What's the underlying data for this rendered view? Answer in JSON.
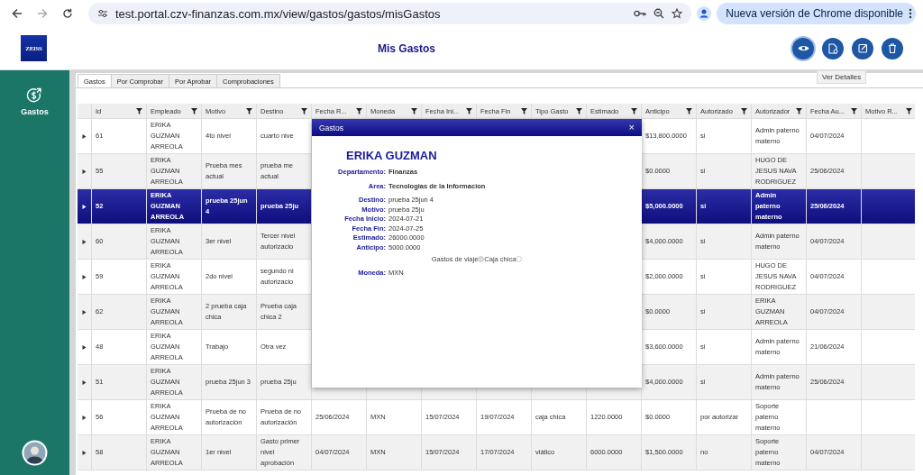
{
  "browser": {
    "url": "test.portal.czv-finanzas.com.mx/view/gastos/gastos/misGastos",
    "update_button": "Nueva versión de Chrome disponible"
  },
  "header": {
    "logo": "ZEISS",
    "title": "Mis Gastos",
    "tooltip": "Ver Detalles",
    "actions": [
      {
        "kind": "view",
        "selected": true
      },
      {
        "kind": "document",
        "selected": false
      },
      {
        "kind": "edit",
        "selected": false
      },
      {
        "kind": "delete",
        "selected": false
      }
    ]
  },
  "sidebar": {
    "items": [
      {
        "label": "Gastos",
        "selected": true
      }
    ]
  },
  "tabs": [
    {
      "label": "Gastos",
      "selected": true
    },
    {
      "label": "Por Comprobar",
      "selected": false
    },
    {
      "label": "Por Aprobar",
      "selected": false
    },
    {
      "label": "Comprobaciones",
      "selected": false
    }
  ],
  "table": {
    "columns": [
      "Id",
      "Empleado",
      "Motivo",
      "Destino",
      "Fecha R...",
      "Moneda",
      "Fecha Ini...",
      "Fecha Fin",
      "Tipo Gasto",
      "Estimado",
      "Anticipo",
      "Autorizado",
      "Autorizador",
      "Fecha Au...",
      "Motivo R..."
    ],
    "rows": [
      {
        "selected": false,
        "expanded": false,
        "id": "61",
        "empleado": "ERIKA GUZMAN ARREOLA",
        "motivo": "4to nivel",
        "destino": "cuarto nive",
        "anticipo": "$13,800.0000",
        "autorizado": "si",
        "autorizador": "Admin paterno materno",
        "fecha_au": "04/07/2024"
      },
      {
        "selected": false,
        "expanded": false,
        "id": "55",
        "empleado": "ERIKA GUZMAN ARREOLA",
        "motivo": "Prueba mes actual",
        "destino": "prueba me actual",
        "anticipo": "$0.0000",
        "autorizado": "si",
        "autorizador": "HUGO DE JESUS NAVA RODRIGUEZ",
        "fecha_au": "25/06/2024"
      },
      {
        "selected": true,
        "expanded": false,
        "id": "52",
        "empleado": "ERIKA GUZMAN ARREOLA",
        "motivo": "prueba 25jun 4",
        "destino": "prueba 25ju",
        "anticipo": "$5,000.0000",
        "autorizado": "si",
        "autorizador": "Admin paterno materno",
        "fecha_au": "25/06/2024"
      },
      {
        "selected": false,
        "expanded": false,
        "id": "60",
        "empleado": "ERIKA GUZMAN ARREOLA",
        "motivo": "3er nivel",
        "destino": "Tercer nivel autorizacio",
        "anticipo": "$4,000.0000",
        "autorizado": "si",
        "autorizador": "Admin paterno materno",
        "fecha_au": "04/07/2024"
      },
      {
        "selected": false,
        "expanded": false,
        "id": "59",
        "empleado": "ERIKA GUZMAN ARREOLA",
        "motivo": "2do nivel",
        "destino": "segundo ni autorizacio",
        "anticipo": "$2,000.0000",
        "autorizado": "si",
        "autorizador": "HUGO DE JESUS NAVA RODRIGUEZ",
        "fecha_au": "04/07/2024"
      },
      {
        "selected": false,
        "expanded": false,
        "id": "62",
        "empleado": "ERIKA GUZMAN ARREOLA",
        "motivo": "2 prueba caja chica",
        "destino": "Prueba caja chica 2",
        "anticipo": "$0.0000",
        "autorizado": "si",
        "autorizador": "ERIKA GUZMAN ARREOLA",
        "fecha_au": "04/07/2024"
      },
      {
        "selected": false,
        "expanded": false,
        "id": "48",
        "empleado": "ERIKA GUZMAN ARREOLA",
        "motivo": "Trabajo",
        "destino": "Otra vez",
        "anticipo": "$3,600.0000",
        "autorizado": "si",
        "autorizador": "Admin paterno materno",
        "fecha_au": "21/06/2024"
      },
      {
        "selected": false,
        "expanded": false,
        "id": "51",
        "empleado": "ERIKA GUZMAN ARREOLA",
        "motivo": "prueba 25jun 3",
        "destino": "prueba 25ju",
        "anticipo": "$4,000.0000",
        "autorizado": "si",
        "autorizador": "Admin paterno materno",
        "fecha_au": "25/06/2024"
      },
      {
        "selected": false,
        "expanded": false,
        "id": "56",
        "empleado": "ERIKA GUZMAN ARREOLA",
        "motivo": "Prueba de no autorización",
        "destino": "Prueba de no autorización",
        "fecha_r": "25/06/2024",
        "moneda": "MXN",
        "fecha_inicio": "15/07/2024",
        "fecha_fin": "19/07/2024",
        "tipo_gasto": "caja chica",
        "estimado": "1220.0000",
        "anticipo": "$0.0000",
        "autorizado": "por autorizar",
        "autorizador": "Soporte paterno materno"
      },
      {
        "selected": false,
        "expanded": false,
        "id": "58",
        "empleado": "ERIKA GUZMAN ARREOLA",
        "motivo": "1er nivel",
        "destino": "Gasto primer nivel aprobación",
        "fecha_r": "04/07/2024",
        "moneda": "MXN",
        "fecha_inicio": "15/07/2024",
        "fecha_fin": "17/07/2024",
        "tipo_gasto": "viático",
        "estimado": "6000.0000",
        "anticipo": "$1,500.0000",
        "autorizado": "no",
        "autorizador": "Soporte paterno materno",
        "fecha_au": "04/07/2024"
      }
    ]
  },
  "dialog": {
    "title": "Gastos",
    "close": "×",
    "name": "ERIKA GUZMAN",
    "summary": [
      {
        "label": "Departamento:",
        "value": "Finanzas"
      },
      {
        "label": "Area:",
        "value": "Tecnologias de la Informacion"
      }
    ],
    "details": [
      {
        "label": "Destino:",
        "value": "prueba 25jun 4"
      },
      {
        "label": "Motivo:",
        "value": "prueba 25ju"
      },
      {
        "label": "Fecha Inicio:",
        "value": "2024-07-21"
      },
      {
        "label": "Fecha Fin:",
        "value": "2024-07-25"
      },
      {
        "label": "Estimado:",
        "value": "26000.0000"
      },
      {
        "label": "Anticipo:",
        "value": "5000.0000"
      }
    ],
    "expense_type": [
      {
        "label": "Gastos de viaje",
        "selected": true
      },
      {
        "label": "Caja chica",
        "selected": false
      }
    ],
    "currency": {
      "label": "Moneda:",
      "value": "MXN"
    }
  }
}
